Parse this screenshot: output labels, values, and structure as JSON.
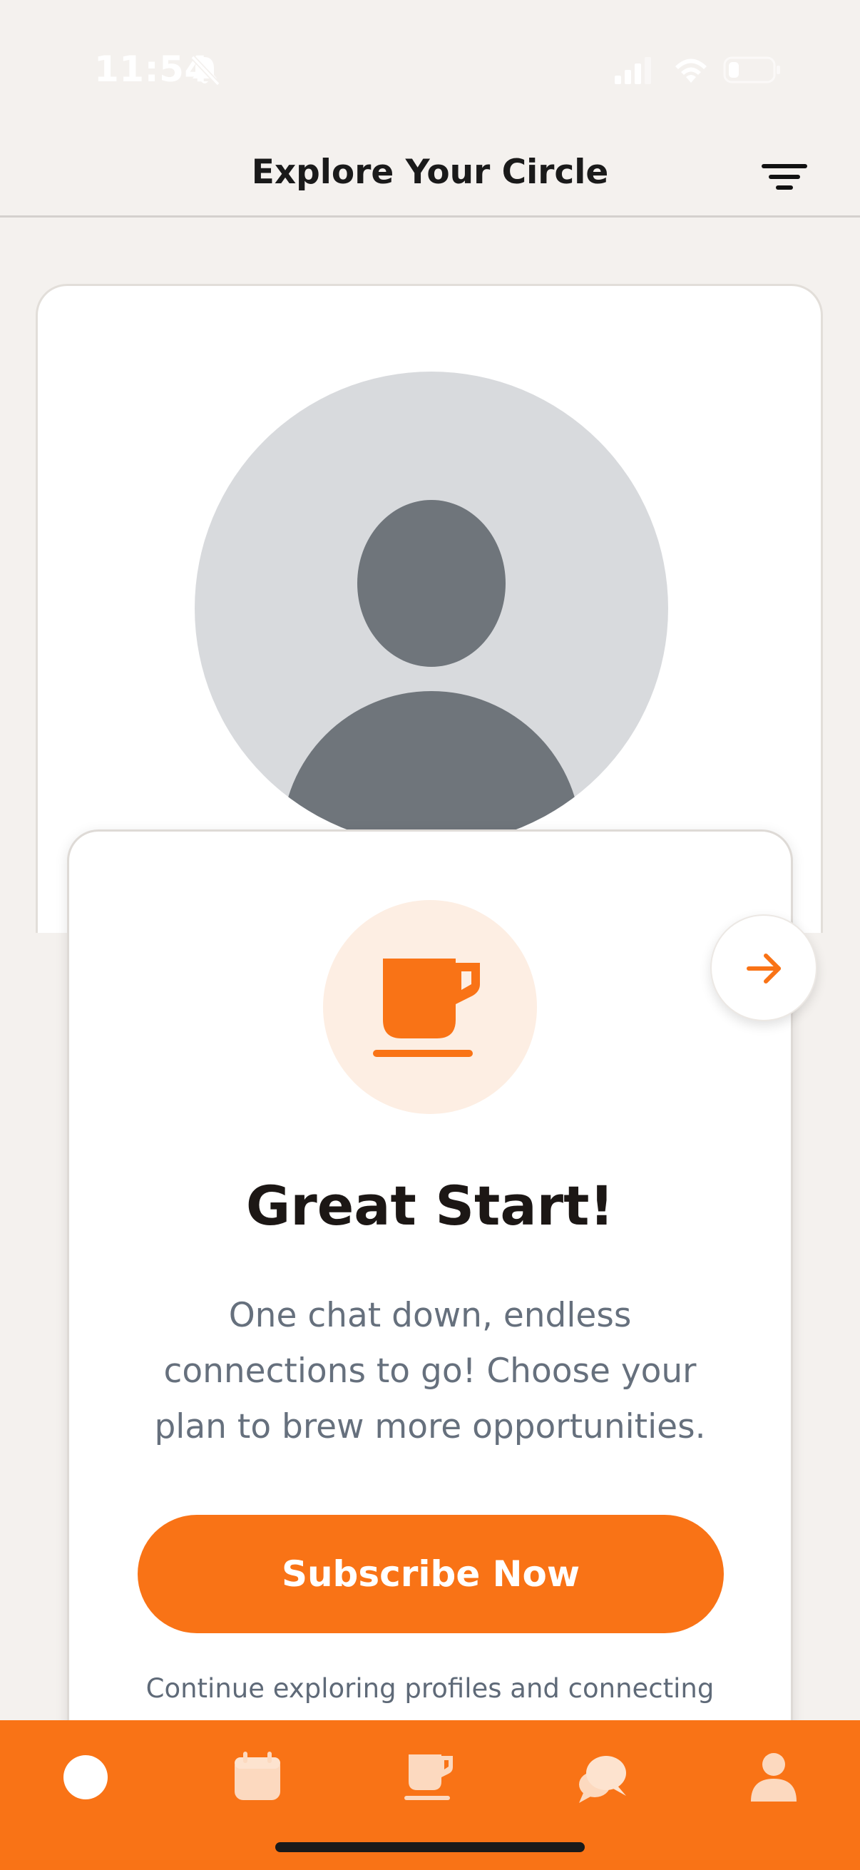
{
  "status_bar": {
    "time": "11:54"
  },
  "header": {
    "title": "Explore Your Circle"
  },
  "modal": {
    "title": "Great Start!",
    "body": "One chat down, endless connections to go! Choose your plan to brew more opportunities.",
    "subscribe_label": "Subscribe Now",
    "continue_text": "Continue exploring profiles and connecting"
  },
  "colors": {
    "accent": "#f97316",
    "accent_light": "#fdeee3",
    "avatar_bg": "#d8dadd",
    "avatar_fg": "#6f757b",
    "background": "#f4f1ee"
  },
  "icons": {
    "filter": "filter-icon",
    "next": "arrow-right-icon",
    "modal_icon": "coffee-cup-icon",
    "nav": [
      "home-icon",
      "calendar-icon",
      "coffee-cup-icon",
      "chat-bubbles-icon",
      "profile-icon"
    ]
  }
}
